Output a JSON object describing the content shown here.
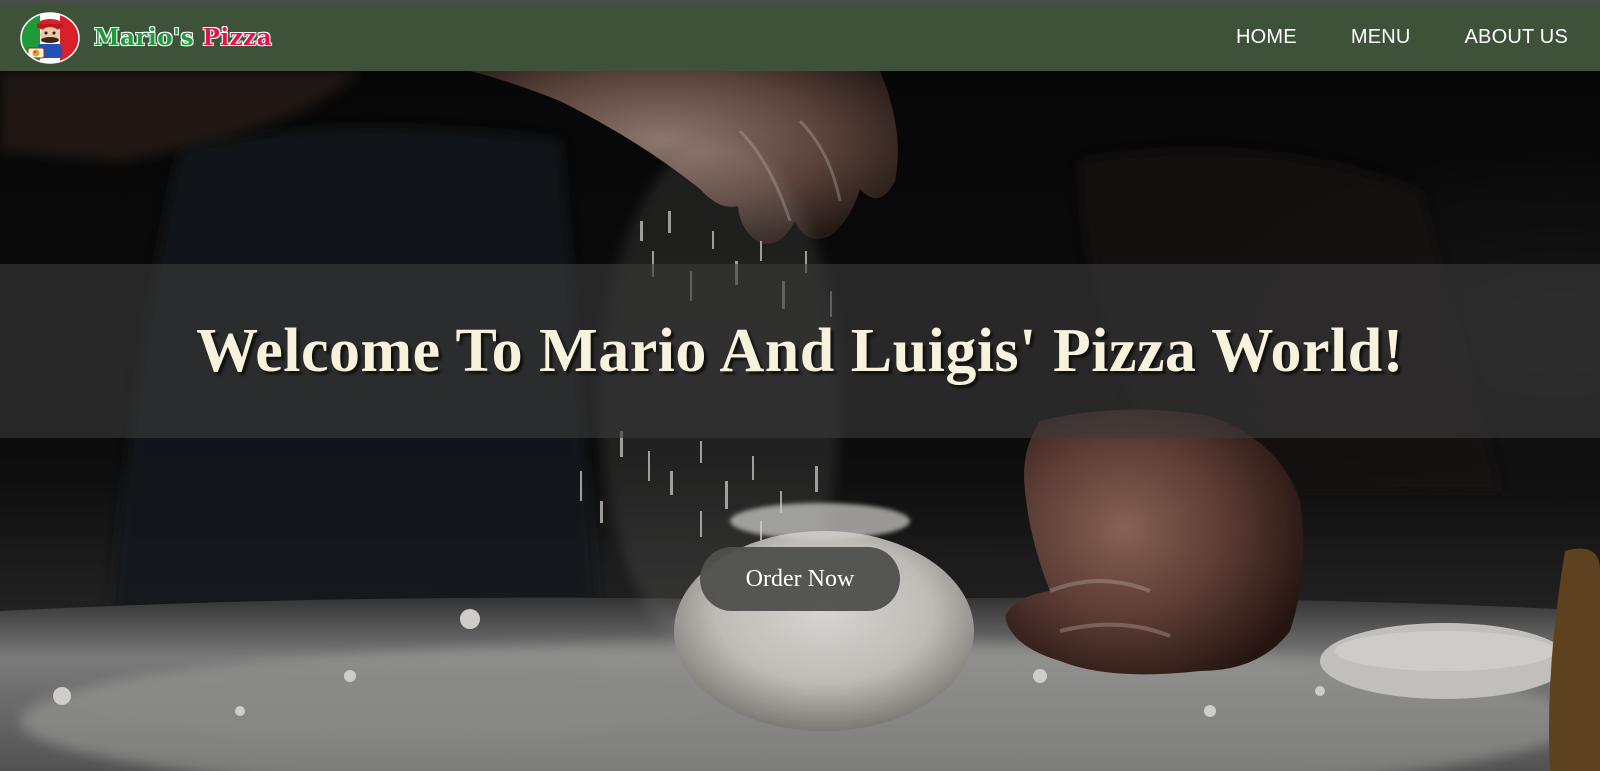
{
  "header": {
    "brand": {
      "name_part1": "Mario's",
      "name_part2": "Pizza",
      "logo_icon": "mario-pizza-logo"
    },
    "nav": [
      {
        "label": "HOME"
      },
      {
        "label": "MENU"
      },
      {
        "label": "ABOUT US"
      }
    ]
  },
  "hero": {
    "background": "dark photo of hands sprinkling flour over pizza dough",
    "title": "Welcome To Mario And Luigis' Pizza World!",
    "cta_label": "Order Now"
  },
  "colors": {
    "navbar": "#3e5139",
    "title_text": "#f6f2dc",
    "brand_green": "#1f9a3a",
    "brand_red": "#e0154c",
    "button_bg": "#50504e"
  }
}
